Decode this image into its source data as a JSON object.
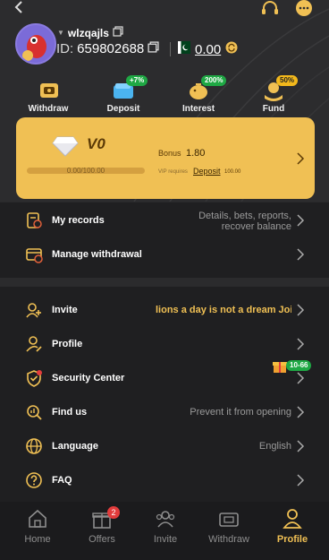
{
  "header": {
    "username": "wlzqajls",
    "id_label": "ID:",
    "id_value": "659802688",
    "balance": "0.00"
  },
  "quick_actions": [
    {
      "label": "Withdraw",
      "badge": ""
    },
    {
      "label": "Deposit",
      "badge": "+7%"
    },
    {
      "label": "Interest",
      "badge": "200%"
    },
    {
      "label": "Fund",
      "badge": "50%"
    }
  ],
  "vip": {
    "level": "V0",
    "progress_text": "0.00/100.00",
    "progress_fraction": 0,
    "bonus_label": "Bonus",
    "bonus_value": "1.80",
    "requires_label": "VIP requires",
    "deposit_link": "Deposit",
    "required_amount": "100.00"
  },
  "menu_top": [
    {
      "label": "My records",
      "right": "Details, bets, reports, recover balance",
      "icon": "records-icon"
    },
    {
      "label": "Manage withdrawal",
      "right": "",
      "icon": "withdrawal-card-icon"
    }
  ],
  "menu_main": [
    {
      "label": "Invite",
      "right": "lions a day is not a dream Joi",
      "icon": "invite-user-icon"
    },
    {
      "label": "Profile",
      "right": "",
      "icon": "profile-edit-icon"
    },
    {
      "label": "Security Center",
      "right": "",
      "icon": "shield-check-icon",
      "badge": "10-66"
    },
    {
      "label": "Find us",
      "right": "Prevent it from opening",
      "icon": "find-search-icon"
    },
    {
      "label": "Language",
      "right": "English",
      "icon": "globe-icon"
    },
    {
      "label": "FAQ",
      "right": "",
      "icon": "question-icon"
    }
  ],
  "nav": [
    {
      "label": "Home",
      "icon": "home-icon"
    },
    {
      "label": "Offers",
      "icon": "gift-icon",
      "badge": "2"
    },
    {
      "label": "Invite",
      "icon": "invite-people-icon"
    },
    {
      "label": "Withdraw",
      "icon": "withdraw-icon"
    },
    {
      "label": "Profile",
      "icon": "profile-person-icon",
      "active": true
    }
  ],
  "colors": {
    "accent": "#f0c054",
    "panel": "#1f1f21",
    "badge_green": "#1fa844"
  }
}
